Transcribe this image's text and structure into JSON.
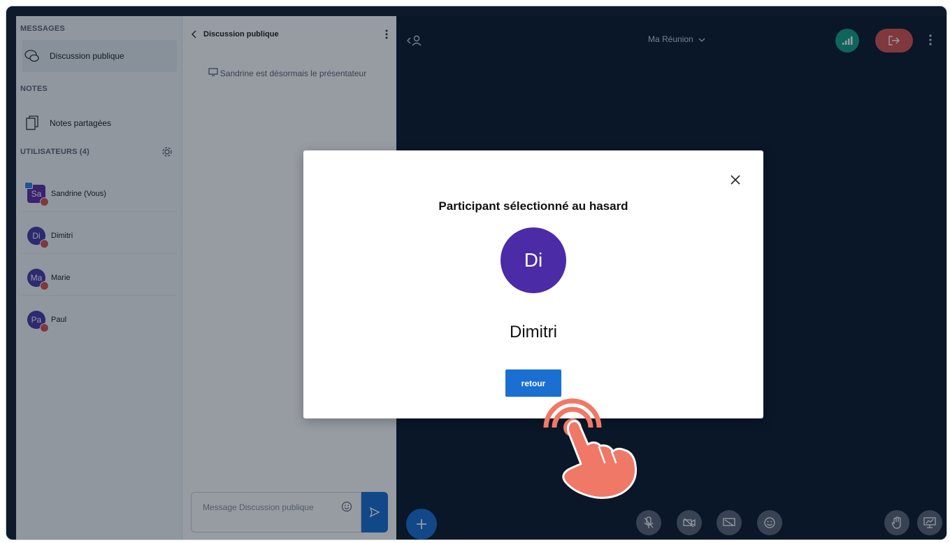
{
  "users_panel": {
    "messages_title": "MESSAGES",
    "public_chat": "Discussion publique",
    "notes_title": "NOTES",
    "shared_notes": "Notes partagées",
    "users_title": "UTILISATEURS (4)",
    "users": [
      {
        "initials": "Sa",
        "name": "Sandrine (Vous)"
      },
      {
        "initials": "Di",
        "name": "Dimitri"
      },
      {
        "initials": "Ma",
        "name": "Marie"
      },
      {
        "initials": "Pa",
        "name": "Paul"
      }
    ]
  },
  "chat": {
    "title": "Discussion publique",
    "system_message": "Sandrine est désormais le présentateur",
    "input_placeholder": "Message Discussion publique"
  },
  "main": {
    "meeting_title": "Ma Réunion"
  },
  "modal": {
    "title": "Participant sélectionné au hasard",
    "avatar_initials": "Di",
    "name": "Dimitri",
    "back_label": "retour"
  },
  "colors": {
    "primary": "#1b6fd1",
    "avatar": "#4b2ba6",
    "leave": "#d9534f",
    "connection": "#16a085",
    "pointer": "#f07866"
  },
  "icons": [
    "chat-icon",
    "notes-icon",
    "gear-icon",
    "chevron-left-icon",
    "more-vertical-icon",
    "presentation-icon",
    "emoji-icon",
    "send-icon",
    "user-list-icon",
    "chevron-down-icon",
    "connection-icon",
    "leave-icon",
    "plus-icon",
    "microphone-off-icon",
    "camera-off-icon",
    "screen-share-icon",
    "reactions-icon",
    "raise-hand-icon",
    "presentation-toggle-icon",
    "close-icon",
    "hand-pointer-icon"
  ]
}
